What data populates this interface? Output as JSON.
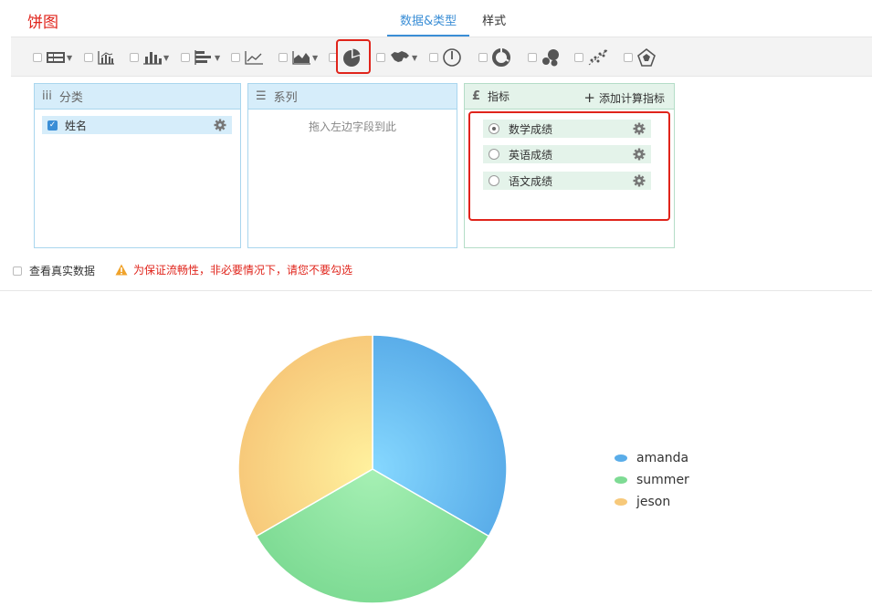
{
  "page": {
    "title": "饼图"
  },
  "tabs": [
    {
      "label": "数据&类型",
      "active": true
    },
    {
      "label": "样式",
      "active": false
    }
  ],
  "toolbar": {
    "chart_types": [
      "table-icon",
      "combo-bar-icon",
      "bar-icon",
      "horizontal-bar-icon",
      "line-icon",
      "area-icon",
      "pie-icon",
      "map-icon",
      "gauge-icon",
      "ring-icon",
      "bubble-icon",
      "scatter-icon",
      "radar-icon"
    ],
    "selected": "pie-icon"
  },
  "panels": {
    "category": {
      "title": "分类",
      "fields": [
        {
          "label": "姓名",
          "checked": true
        }
      ]
    },
    "series": {
      "title": "系列",
      "hint": "拖入左边字段到此"
    },
    "indicator": {
      "title": "指标",
      "add_label": "添加计算指标",
      "measures": [
        {
          "label": "数学成绩",
          "selected": true
        },
        {
          "label": "英语成绩",
          "selected": false
        },
        {
          "label": "语文成绩",
          "selected": false
        }
      ]
    }
  },
  "options": {
    "real_data_label": "查看真实数据",
    "warning": "为保证流畅性，非必要情况下，请您不要勾选"
  },
  "colors": {
    "accent": "#3a8ed6",
    "alert": "#e0241b",
    "amanda": "#5aade9",
    "summer": "#7edb94",
    "jeson": "#f7c97a"
  },
  "chart_data": {
    "type": "pie",
    "categories": [
      "amanda",
      "summer",
      "jeson"
    ],
    "values": [
      1,
      1,
      1
    ],
    "legend": "right"
  }
}
